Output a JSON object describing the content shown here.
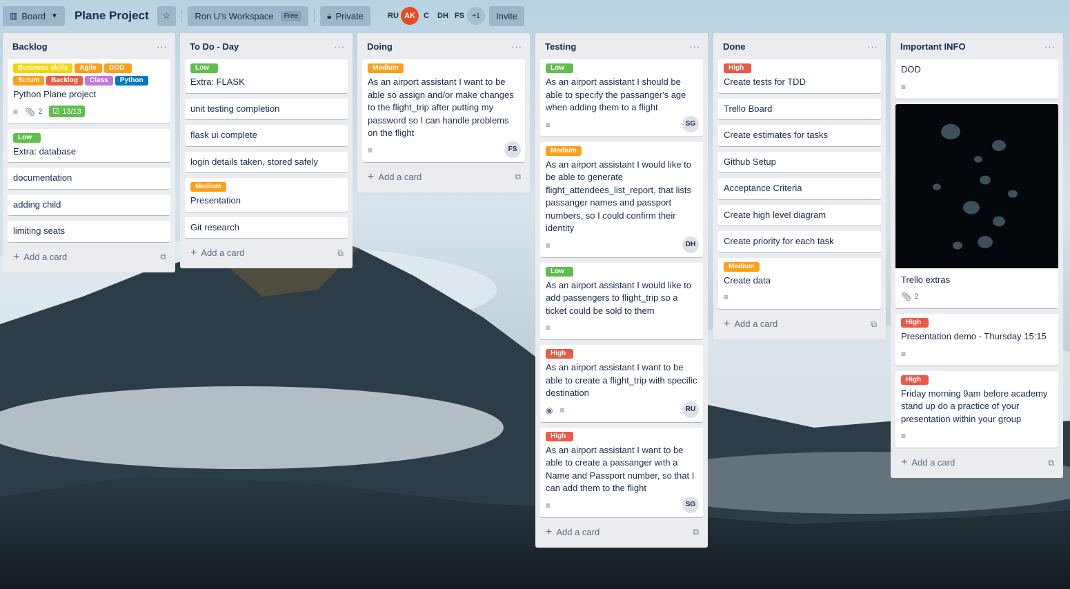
{
  "topbar": {
    "board_view_label": "Board",
    "board_title": "Plane Project",
    "workspace_label": "Ron U's Workspace",
    "workspace_badge": "Free",
    "visibility_label": "Private",
    "members": [
      "RU",
      "AK",
      "C",
      "DH",
      "FS"
    ],
    "members_more": "+1",
    "invite_label": "Invite"
  },
  "add_card_label": "Add a card",
  "label_colors": {
    "green": "#61bd4f",
    "orange": "#ff9f1a",
    "yellow": "#f2d600",
    "red": "#eb5a46",
    "purple": "#c377e0",
    "blue": "#0079bf"
  },
  "lists": [
    {
      "title": "Backlog",
      "cards": [
        {
          "labels": [
            {
              "text": "Business skills",
              "color": "#f2d600"
            },
            {
              "text": "Agile",
              "color": "#ff9f1a"
            },
            {
              "text": "DOD",
              "color": "#ff9f1a"
            },
            {
              "text": "Scrum",
              "color": "#ff9f1a"
            },
            {
              "text": "Backlog",
              "color": "#eb5a46"
            },
            {
              "text": "Class",
              "color": "#c377e0"
            },
            {
              "text": "Python",
              "color": "#0079bf"
            }
          ],
          "title": "Python Plane project",
          "attachments": "2",
          "checklist": "13/13"
        },
        {
          "labels": [
            {
              "text": "Low",
              "color": "#61bd4f"
            }
          ],
          "title": "Extra: database"
        },
        {
          "title": "documentation"
        },
        {
          "title": "adding child"
        },
        {
          "title": "limiting seats"
        }
      ]
    },
    {
      "title": "To Do - Day",
      "cards": [
        {
          "labels": [
            {
              "text": "Low",
              "color": "#61bd4f"
            }
          ],
          "title": "Extra: FLASK"
        },
        {
          "title": "unit testing completion"
        },
        {
          "title": "flask ui complete"
        },
        {
          "title": "login details taken, stored safely"
        },
        {
          "labels": [
            {
              "text": "Medium",
              "color": "#ff9f1a"
            }
          ],
          "title": "Presentation"
        },
        {
          "title": "Git research"
        }
      ]
    },
    {
      "title": "Doing",
      "cards": [
        {
          "labels": [
            {
              "text": "Medium",
              "color": "#ff9f1a"
            }
          ],
          "title": "As an airport assistant I want to be able so assign and/or make changes to the flight_trip after putting my password so I can handle problems on the flight",
          "member": "FS"
        }
      ]
    },
    {
      "title": "Testing",
      "cards": [
        {
          "labels": [
            {
              "text": "Low",
              "color": "#61bd4f"
            }
          ],
          "title": "As an airport assistant I should be able to specify the passanger's age when adding them to a flight",
          "member": "SG"
        },
        {
          "labels": [
            {
              "text": "Medium",
              "color": "#ff9f1a"
            }
          ],
          "title": "As an airport assistant I would like to be able to generate flight_attendees_list_report, that lists passanger names and passport numbers, so I could confirm their identity",
          "member": "DH"
        },
        {
          "labels": [
            {
              "text": "Low",
              "color": "#61bd4f"
            }
          ],
          "title": "As an airport assistant I would like to add passengers to flight_trip so a ticket could be sold to them"
        },
        {
          "labels": [
            {
              "text": "High",
              "color": "#eb5a46"
            }
          ],
          "title": "As an airport assistant I want to be able to create a flight_trip with specific destination",
          "member": "RU",
          "watching": true
        },
        {
          "labels": [
            {
              "text": "High",
              "color": "#eb5a46"
            }
          ],
          "title": "As an airport assistant I want to be able to create a passanger with a Name and Passport number, so that I can add them to the flight",
          "member": "SG"
        }
      ]
    },
    {
      "title": "Done",
      "cards": [
        {
          "labels": [
            {
              "text": "High",
              "color": "#eb5a46"
            }
          ],
          "title": "Create tests for TDD"
        },
        {
          "title": "Trello Board"
        },
        {
          "title": "Create estimates for tasks"
        },
        {
          "title": "Github Setup"
        },
        {
          "title": "Acceptance Criteria"
        },
        {
          "title": "Create high level diagram"
        },
        {
          "title": "Create priority for each task"
        },
        {
          "labels": [
            {
              "text": "Medium",
              "color": "#ff9f1a"
            }
          ],
          "title": "Create data"
        }
      ]
    },
    {
      "title": "Important INFO",
      "cards": [
        {
          "title": "DOD"
        },
        {
          "title": "Trello extras",
          "attachments": "2"
        },
        {
          "labels": [
            {
              "text": "High",
              "color": "#eb5a46"
            }
          ],
          "title": "Presentation demo - Thursday 15:15"
        },
        {
          "labels": [
            {
              "text": "High",
              "color": "#eb5a46"
            }
          ],
          "title": "Friday morning 9am before academy stand up do a practice of your presentation within your group"
        }
      ]
    }
  ]
}
